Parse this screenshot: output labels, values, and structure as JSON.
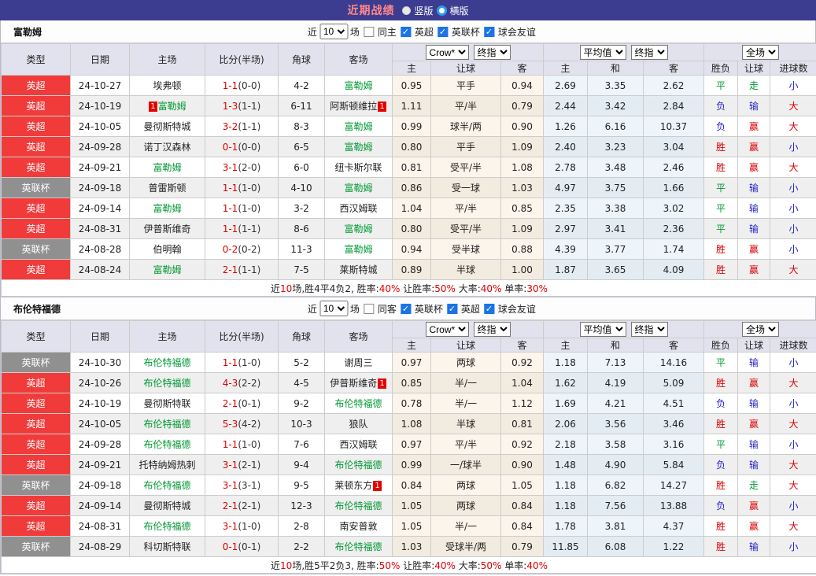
{
  "topbar": {
    "title": "近期战绩",
    "radios": [
      {
        "label": "竖版",
        "selected": false
      },
      {
        "label": "横版",
        "selected": true
      }
    ]
  },
  "labels": {
    "near": "近",
    "count": "10",
    "matches": "场"
  },
  "head": {
    "type": "类型",
    "date": "日期",
    "home": "主场",
    "score": "比分(半场)",
    "corner": "角球",
    "away": "客场",
    "odds_home": "主",
    "odds_handicap": "让球",
    "odds_away": "客",
    "avg_home": "主",
    "avg_draw": "和",
    "avg_away": "客",
    "result": "胜负",
    "result_handicap": "让球",
    "goals": "进球数",
    "selects": {
      "source": "Crow*",
      "final_a": "终指",
      "average": "平均值",
      "final_b": "终指",
      "scope": "全场"
    }
  },
  "colors": {
    "topbar_bg": "#3C3C90",
    "title_red": "#FF8A8A",
    "league_red": "#F13B3B",
    "cup_gray": "#909090",
    "team_green": "#009933",
    "win_red": "#DD0000",
    "draw_green": "#009933",
    "lose_blue": "#2424CC",
    "odds_bg": "#FCF5EB",
    "avg_bg": "#EDF5FB",
    "checkbox_blue": "#1A73E8",
    "score_red": "#E00000"
  },
  "sections": [
    {
      "team": "富勒姆",
      "same_label": "同主",
      "same_checked": false,
      "filters": [
        {
          "label": "英超",
          "checked": true
        },
        {
          "label": "英联杯",
          "checked": true
        },
        {
          "label": "球会友谊",
          "checked": true
        }
      ],
      "rows": [
        {
          "league": "英超",
          "cup": false,
          "date": "24-10-27",
          "home": "埃弗顿",
          "home_green": false,
          "home_badge": "",
          "score": "1-1",
          "half": "(0-0)",
          "corner": "4-2",
          "away": "富勒姆",
          "away_green": true,
          "away_badge": "",
          "odds": [
            "0.95",
            "平手",
            "0.94"
          ],
          "avg": [
            "2.69",
            "3.35",
            "2.62"
          ],
          "res": [
            [
              "平",
              "g"
            ],
            [
              "走",
              "g"
            ],
            [
              "小",
              "b"
            ]
          ]
        },
        {
          "league": "英超",
          "cup": false,
          "date": "24-10-19",
          "home": "富勒姆",
          "home_green": true,
          "home_badge": "before",
          "score": "1-3",
          "half": "(1-1)",
          "corner": "6-11",
          "away": "阿斯顿维拉",
          "away_green": false,
          "away_badge": "after",
          "odds": [
            "1.11",
            "平/半",
            "0.79"
          ],
          "avg": [
            "2.44",
            "3.42",
            "2.84"
          ],
          "res": [
            [
              "负",
              "b"
            ],
            [
              "输",
              "b"
            ],
            [
              "大",
              "r"
            ]
          ]
        },
        {
          "league": "英超",
          "cup": false,
          "date": "24-10-05",
          "home": "曼彻斯特城",
          "home_green": false,
          "home_badge": "",
          "score": "3-2",
          "half": "(1-1)",
          "corner": "8-3",
          "away": "富勒姆",
          "away_green": true,
          "away_badge": "",
          "odds": [
            "0.99",
            "球半/两",
            "0.90"
          ],
          "avg": [
            "1.26",
            "6.16",
            "10.37"
          ],
          "res": [
            [
              "负",
              "b"
            ],
            [
              "赢",
              "r"
            ],
            [
              "大",
              "r"
            ]
          ]
        },
        {
          "league": "英超",
          "cup": false,
          "date": "24-09-28",
          "home": "诺丁汉森林",
          "home_green": false,
          "home_badge": "",
          "score": "0-1",
          "half": "(0-0)",
          "corner": "6-5",
          "away": "富勒姆",
          "away_green": true,
          "away_badge": "",
          "odds": [
            "0.80",
            "平手",
            "1.09"
          ],
          "avg": [
            "2.40",
            "3.23",
            "3.04"
          ],
          "res": [
            [
              "胜",
              "r"
            ],
            [
              "赢",
              "r"
            ],
            [
              "小",
              "b"
            ]
          ]
        },
        {
          "league": "英超",
          "cup": false,
          "date": "24-09-21",
          "home": "富勒姆",
          "home_green": true,
          "home_badge": "",
          "score": "3-1",
          "half": "(2-0)",
          "corner": "6-0",
          "away": "纽卡斯尔联",
          "away_green": false,
          "away_badge": "",
          "odds": [
            "0.81",
            "受平/半",
            "1.08"
          ],
          "avg": [
            "2.78",
            "3.48",
            "2.46"
          ],
          "res": [
            [
              "胜",
              "r"
            ],
            [
              "赢",
              "r"
            ],
            [
              "大",
              "r"
            ]
          ]
        },
        {
          "league": "英联杯",
          "cup": true,
          "date": "24-09-18",
          "home": "普雷斯顿",
          "home_green": false,
          "home_badge": "",
          "score": "1-1",
          "half": "(1-0)",
          "corner": "4-10",
          "away": "富勒姆",
          "away_green": true,
          "away_badge": "",
          "odds": [
            "0.86",
            "受一球",
            "1.03"
          ],
          "avg": [
            "4.97",
            "3.75",
            "1.66"
          ],
          "res": [
            [
              "平",
              "g"
            ],
            [
              "输",
              "b"
            ],
            [
              "小",
              "b"
            ]
          ]
        },
        {
          "league": "英超",
          "cup": false,
          "date": "24-09-14",
          "home": "富勒姆",
          "home_green": true,
          "home_badge": "",
          "score": "1-1",
          "half": "(1-0)",
          "corner": "3-2",
          "away": "西汉姆联",
          "away_green": false,
          "away_badge": "",
          "odds": [
            "1.04",
            "平/半",
            "0.85"
          ],
          "avg": [
            "2.35",
            "3.38",
            "3.02"
          ],
          "res": [
            [
              "平",
              "g"
            ],
            [
              "输",
              "b"
            ],
            [
              "小",
              "b"
            ]
          ]
        },
        {
          "league": "英超",
          "cup": false,
          "date": "24-08-31",
          "home": "伊普斯维奇",
          "home_green": false,
          "home_badge": "",
          "score": "1-1",
          "half": "(1-1)",
          "corner": "8-6",
          "away": "富勒姆",
          "away_green": true,
          "away_badge": "",
          "odds": [
            "0.80",
            "受平/半",
            "1.09"
          ],
          "avg": [
            "2.97",
            "3.41",
            "2.36"
          ],
          "res": [
            [
              "平",
              "g"
            ],
            [
              "输",
              "b"
            ],
            [
              "小",
              "b"
            ]
          ]
        },
        {
          "league": "英联杯",
          "cup": true,
          "date": "24-08-28",
          "home": "伯明翰",
          "home_green": false,
          "home_badge": "",
          "score": "0-2",
          "half": "(0-2)",
          "corner": "11-3",
          "away": "富勒姆",
          "away_green": true,
          "away_badge": "",
          "odds": [
            "0.94",
            "受半球",
            "0.88"
          ],
          "avg": [
            "4.39",
            "3.77",
            "1.74"
          ],
          "res": [
            [
              "胜",
              "r"
            ],
            [
              "赢",
              "r"
            ],
            [
              "小",
              "b"
            ]
          ]
        },
        {
          "league": "英超",
          "cup": false,
          "date": "24-08-24",
          "home": "富勒姆",
          "home_green": true,
          "home_badge": "",
          "score": "2-1",
          "half": "(1-1)",
          "corner": "7-5",
          "away": "莱斯特城",
          "away_green": false,
          "away_badge": "",
          "odds": [
            "0.89",
            "半球",
            "1.00"
          ],
          "avg": [
            "1.87",
            "3.65",
            "4.09"
          ],
          "res": [
            [
              "胜",
              "r"
            ],
            [
              "赢",
              "r"
            ],
            [
              "大",
              "r"
            ]
          ]
        }
      ],
      "summary": [
        {
          "t": "近"
        },
        {
          "t": "10",
          "red": true
        },
        {
          "t": "场,胜4平4负2, 胜率:"
        },
        {
          "t": "40%",
          "red": true
        },
        {
          "t": " 让胜率:"
        },
        {
          "t": "50%",
          "red": true
        },
        {
          "t": " 大率:"
        },
        {
          "t": "40%",
          "red": true
        },
        {
          "t": " 单率:"
        },
        {
          "t": "30%",
          "red": true
        }
      ]
    },
    {
      "team": "布伦特福德",
      "same_label": "同客",
      "same_checked": false,
      "filters": [
        {
          "label": "英联杯",
          "checked": true
        },
        {
          "label": "英超",
          "checked": true
        },
        {
          "label": "球会友谊",
          "checked": true
        }
      ],
      "rows": [
        {
          "league": "英联杯",
          "cup": true,
          "date": "24-10-30",
          "home": "布伦特福德",
          "home_green": true,
          "home_badge": "",
          "score": "1-1",
          "half": "(1-0)",
          "corner": "5-2",
          "away": "谢周三",
          "away_green": false,
          "away_badge": "",
          "odds": [
            "0.97",
            "两球",
            "0.92"
          ],
          "avg": [
            "1.18",
            "7.13",
            "14.16"
          ],
          "res": [
            [
              "平",
              "g"
            ],
            [
              "输",
              "b"
            ],
            [
              "小",
              "b"
            ]
          ]
        },
        {
          "league": "英超",
          "cup": false,
          "date": "24-10-26",
          "home": "布伦特福德",
          "home_green": true,
          "home_badge": "",
          "score": "4-3",
          "half": "(2-2)",
          "corner": "4-5",
          "away": "伊普斯维奇",
          "away_green": false,
          "away_badge": "after",
          "odds": [
            "0.85",
            "半/一",
            "1.04"
          ],
          "avg": [
            "1.62",
            "4.19",
            "5.09"
          ],
          "res": [
            [
              "胜",
              "r"
            ],
            [
              "赢",
              "r"
            ],
            [
              "大",
              "r"
            ]
          ]
        },
        {
          "league": "英超",
          "cup": false,
          "date": "24-10-19",
          "home": "曼彻斯特联",
          "home_green": false,
          "home_badge": "",
          "score": "2-1",
          "half": "(0-1)",
          "corner": "9-2",
          "away": "布伦特福德",
          "away_green": true,
          "away_badge": "",
          "odds": [
            "0.78",
            "半/一",
            "1.12"
          ],
          "avg": [
            "1.69",
            "4.21",
            "4.51"
          ],
          "res": [
            [
              "负",
              "b"
            ],
            [
              "输",
              "b"
            ],
            [
              "小",
              "b"
            ]
          ]
        },
        {
          "league": "英超",
          "cup": false,
          "date": "24-10-05",
          "home": "布伦特福德",
          "home_green": true,
          "home_badge": "",
          "score": "5-3",
          "half": "(4-2)",
          "corner": "10-3",
          "away": "狼队",
          "away_green": false,
          "away_badge": "",
          "odds": [
            "1.08",
            "半球",
            "0.81"
          ],
          "avg": [
            "2.06",
            "3.56",
            "3.46"
          ],
          "res": [
            [
              "胜",
              "r"
            ],
            [
              "赢",
              "r"
            ],
            [
              "大",
              "r"
            ]
          ]
        },
        {
          "league": "英超",
          "cup": false,
          "date": "24-09-28",
          "home": "布伦特福德",
          "home_green": true,
          "home_badge": "",
          "score": "1-1",
          "half": "(1-0)",
          "corner": "7-6",
          "away": "西汉姆联",
          "away_green": false,
          "away_badge": "",
          "odds": [
            "0.97",
            "平/半",
            "0.92"
          ],
          "avg": [
            "2.18",
            "3.58",
            "3.16"
          ],
          "res": [
            [
              "平",
              "g"
            ],
            [
              "输",
              "b"
            ],
            [
              "小",
              "b"
            ]
          ]
        },
        {
          "league": "英超",
          "cup": false,
          "date": "24-09-21",
          "home": "托特纳姆热刺",
          "home_green": false,
          "home_badge": "",
          "score": "3-1",
          "half": "(2-1)",
          "corner": "9-4",
          "away": "布伦特福德",
          "away_green": true,
          "away_badge": "",
          "odds": [
            "0.99",
            "一/球半",
            "0.90"
          ],
          "avg": [
            "1.48",
            "4.90",
            "5.84"
          ],
          "res": [
            [
              "负",
              "b"
            ],
            [
              "输",
              "b"
            ],
            [
              "大",
              "r"
            ]
          ]
        },
        {
          "league": "英联杯",
          "cup": true,
          "date": "24-09-18",
          "home": "布伦特福德",
          "home_green": true,
          "home_badge": "",
          "score": "3-1",
          "half": "(3-1)",
          "corner": "9-5",
          "away": "莱顿东方",
          "away_green": false,
          "away_badge": "after",
          "odds": [
            "0.84",
            "两球",
            "1.05"
          ],
          "avg": [
            "1.18",
            "6.82",
            "14.27"
          ],
          "res": [
            [
              "胜",
              "r"
            ],
            [
              "走",
              "g"
            ],
            [
              "大",
              "r"
            ]
          ]
        },
        {
          "league": "英超",
          "cup": false,
          "date": "24-09-14",
          "home": "曼彻斯特城",
          "home_green": false,
          "home_badge": "",
          "score": "2-1",
          "half": "(2-1)",
          "corner": "12-3",
          "away": "布伦特福德",
          "away_green": true,
          "away_badge": "",
          "odds": [
            "1.05",
            "两球",
            "0.84"
          ],
          "avg": [
            "1.18",
            "7.56",
            "13.88"
          ],
          "res": [
            [
              "负",
              "b"
            ],
            [
              "赢",
              "r"
            ],
            [
              "小",
              "b"
            ]
          ]
        },
        {
          "league": "英超",
          "cup": false,
          "date": "24-08-31",
          "home": "布伦特福德",
          "home_green": true,
          "home_badge": "",
          "score": "3-1",
          "half": "(1-0)",
          "corner": "2-8",
          "away": "南安普敦",
          "away_green": false,
          "away_badge": "",
          "odds": [
            "1.05",
            "半/一",
            "0.84"
          ],
          "avg": [
            "1.78",
            "3.81",
            "4.37"
          ],
          "res": [
            [
              "胜",
              "r"
            ],
            [
              "赢",
              "r"
            ],
            [
              "大",
              "r"
            ]
          ]
        },
        {
          "league": "英联杯",
          "cup": true,
          "date": "24-08-29",
          "home": "科切斯特联",
          "home_green": false,
          "home_badge": "",
          "score": "0-1",
          "half": "(0-1)",
          "corner": "2-2",
          "away": "布伦特福德",
          "away_green": true,
          "away_badge": "",
          "odds": [
            "1.03",
            "受球半/两",
            "0.79"
          ],
          "avg": [
            "11.85",
            "6.08",
            "1.22"
          ],
          "res": [
            [
              "胜",
              "r"
            ],
            [
              "输",
              "b"
            ],
            [
              "小",
              "b"
            ]
          ]
        }
      ],
      "summary": [
        {
          "t": "近"
        },
        {
          "t": "10",
          "red": true
        },
        {
          "t": "场,胜5平2负3, 胜率:"
        },
        {
          "t": "50%",
          "red": true
        },
        {
          "t": " 让胜率:"
        },
        {
          "t": "40%",
          "red": true
        },
        {
          "t": " 大率:"
        },
        {
          "t": "50%",
          "red": true
        },
        {
          "t": " 单率:"
        },
        {
          "t": "40%",
          "red": true
        }
      ]
    }
  ]
}
